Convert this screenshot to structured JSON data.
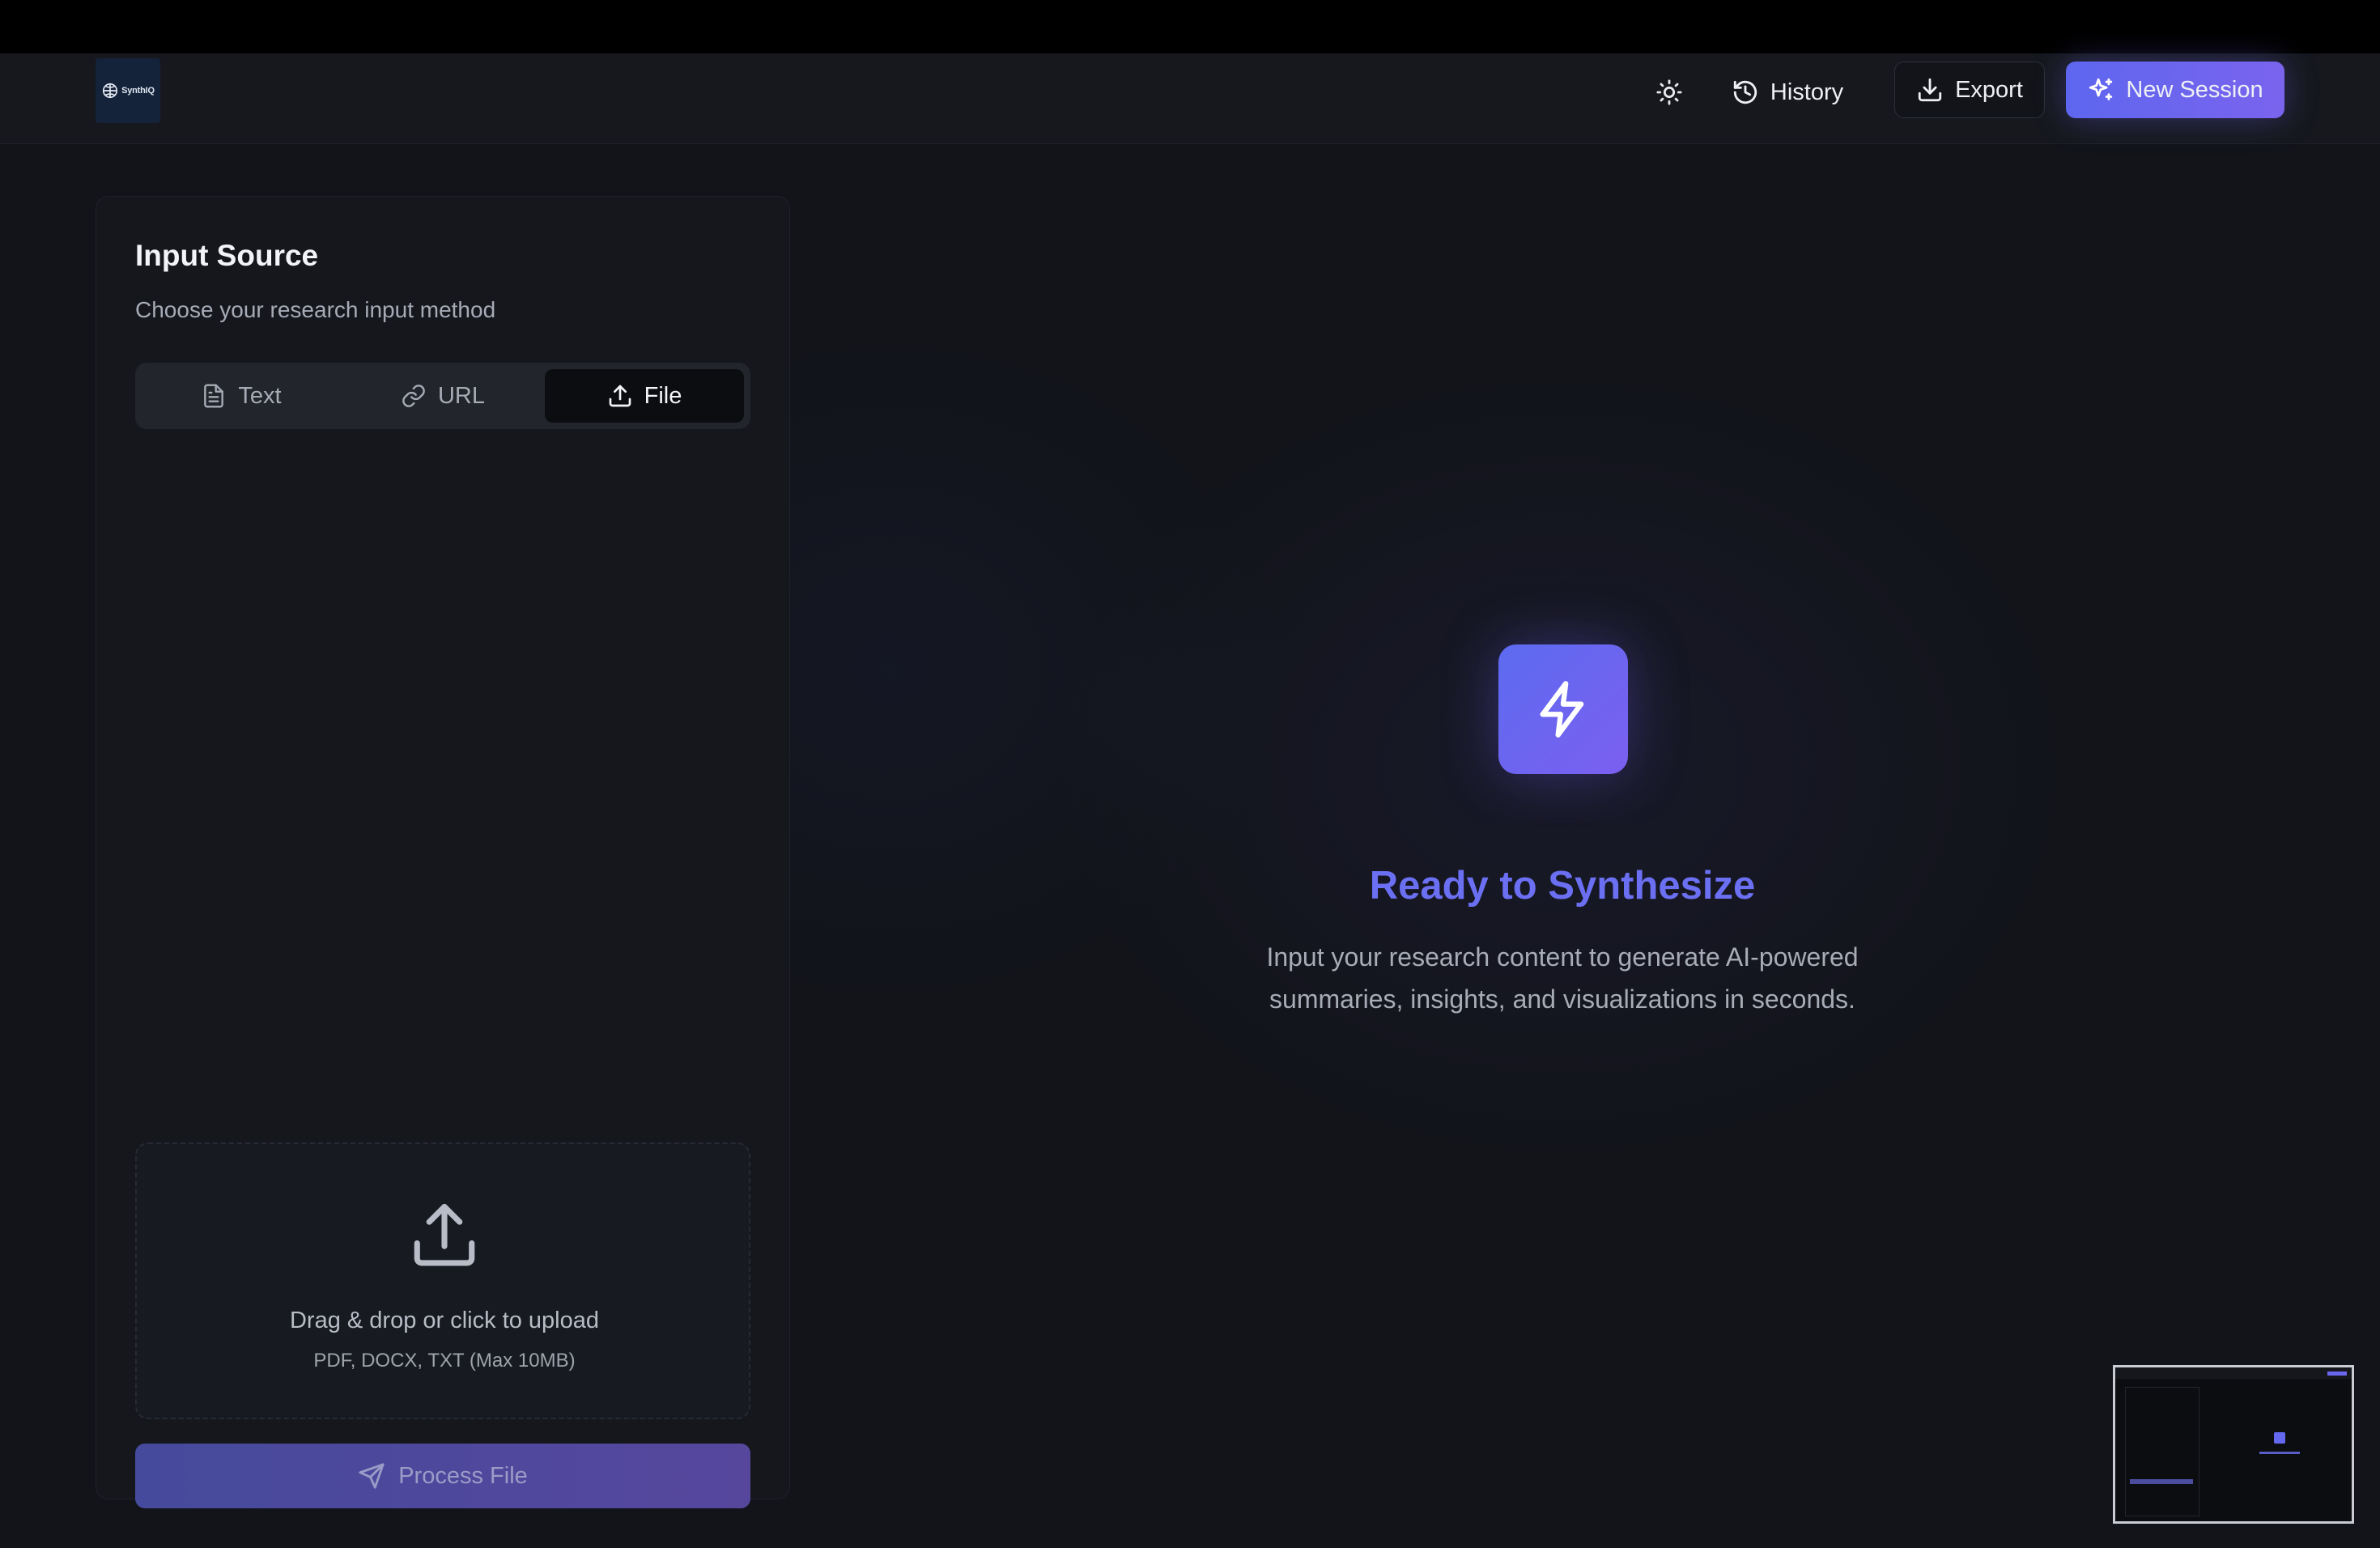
{
  "header": {
    "logo_text": "SynthIQ",
    "history_label": "History",
    "export_label": "Export",
    "new_session_label": "New Session"
  },
  "input_panel": {
    "title": "Input Source",
    "subtitle": "Choose your research input method",
    "tabs": [
      {
        "label": "Text",
        "icon": "file-text-icon",
        "active": false
      },
      {
        "label": "URL",
        "icon": "link-icon",
        "active": false
      },
      {
        "label": "File",
        "icon": "upload-icon",
        "active": true
      }
    ],
    "dropzone": {
      "title": "Drag & drop or click to upload",
      "hint": "PDF, DOCX, TXT (Max 10MB)"
    },
    "process_button_label": "Process File"
  },
  "main": {
    "title": "Ready to Synthesize",
    "description_line1": "Input your research content to generate AI-powered",
    "description_line2": "summaries, insights, and visualizations in seconds."
  },
  "colors": {
    "accent": "#6366f1",
    "accent_violet": "#7c5ff0",
    "background": "#12141a",
    "panel": "#15171d"
  }
}
